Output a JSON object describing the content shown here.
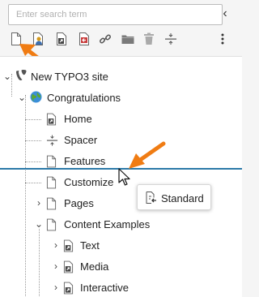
{
  "search": {
    "placeholder": "Enter search term",
    "value": ""
  },
  "collapse_icon": "chevron-left-icon",
  "toolbar": {
    "tools": [
      "page-new-icon",
      "page-backend-user-icon",
      "page-shortcut-icon",
      "page-link-external-icon",
      "link-icon",
      "folder-icon",
      "recycler-icon",
      "spacer-icon"
    ],
    "more_icon": "more-vertical-icon"
  },
  "tree": {
    "root": {
      "label": "New TYPO3 site",
      "icon": "typo3-logo-icon"
    },
    "nodes": [
      {
        "label": "Congratulations",
        "icon": "globe-icon"
      },
      {
        "label": "Home",
        "icon": "page-shortcut-icon"
      },
      {
        "label": "Spacer",
        "icon": "spacer-icon"
      },
      {
        "label": "Features",
        "icon": "page-icon"
      },
      {
        "label": "Customize",
        "icon": "page-icon"
      },
      {
        "label": "Pages",
        "icon": "page-icon"
      },
      {
        "label": "Content Examples",
        "icon": "page-icon"
      },
      {
        "label": "Text",
        "icon": "page-shortcut-icon"
      },
      {
        "label": "Media",
        "icon": "page-shortcut-icon"
      },
      {
        "label": "Interactive",
        "icon": "page-shortcut-icon"
      }
    ]
  },
  "drag_tooltip": {
    "label": "Standard",
    "icon": "page-insert-after-icon"
  },
  "colors": {
    "drop_indicator": "#2c7aa8",
    "annotation_arrow": "#f07c13",
    "background": "#f5f5f5"
  }
}
